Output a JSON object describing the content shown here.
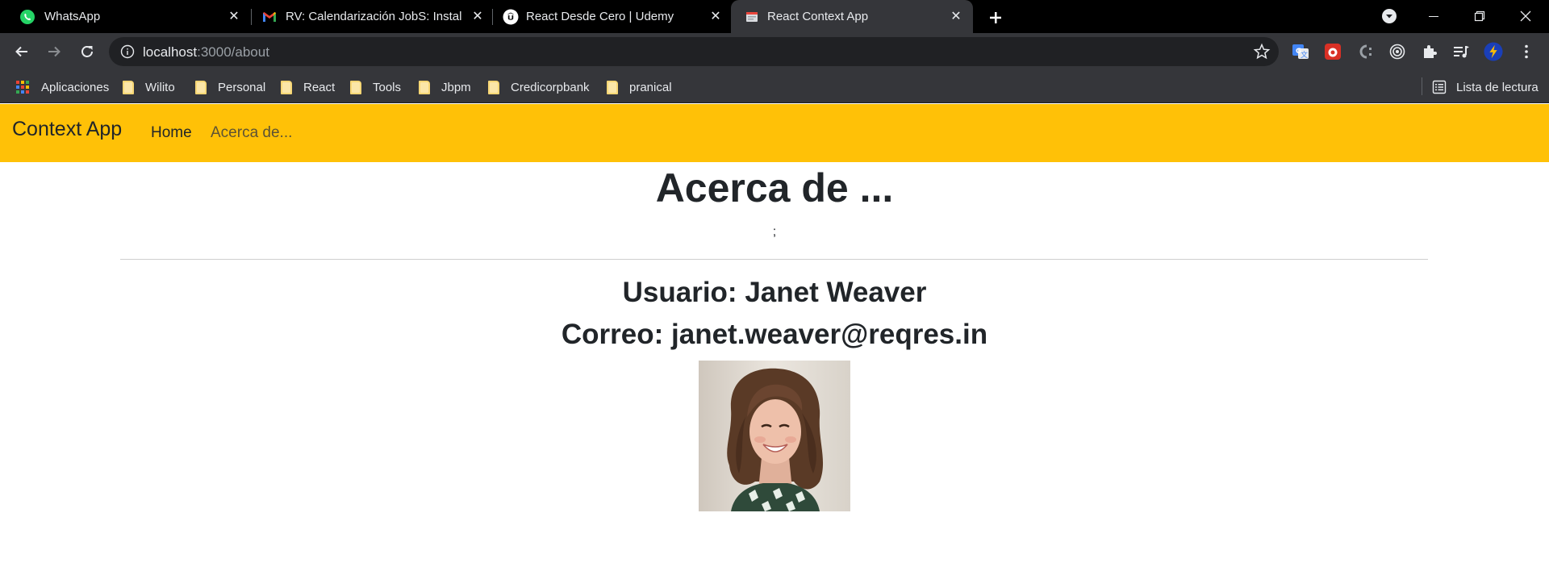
{
  "browser": {
    "tabs": [
      {
        "title": "WhatsApp",
        "icon": "whatsapp-icon",
        "active": false
      },
      {
        "title": "RV: Calendarización JobS: Instalar",
        "icon": "gmail-icon",
        "active": false
      },
      {
        "title": "React Desde Cero | Udemy",
        "icon": "udemy-icon",
        "active": false
      },
      {
        "title": "React Context App",
        "icon": "page-icon",
        "active": true
      }
    ],
    "address": {
      "host": "localhost",
      "path": ":3000/about"
    },
    "bookmarks": [
      {
        "label": "Aplicaciones",
        "icon": "apps-grid-icon"
      },
      {
        "label": "Wilito",
        "icon": "folder-icon"
      },
      {
        "label": "Personal",
        "icon": "folder-icon"
      },
      {
        "label": "React",
        "icon": "folder-icon"
      },
      {
        "label": "Tools",
        "icon": "folder-icon"
      },
      {
        "label": "Jbpm",
        "icon": "folder-icon"
      },
      {
        "label": "Credicorpbank",
        "icon": "folder-icon"
      },
      {
        "label": "pranical",
        "icon": "folder-icon"
      }
    ],
    "reading_list": "Lista de lectura"
  },
  "app": {
    "brand": "Context App",
    "nav": {
      "home": "Home",
      "about": "Acerca de..."
    },
    "accent_color": "#ffc107"
  },
  "page": {
    "title": "Acerca de ...",
    "subtitle": ";",
    "user_label": "Usuario: Janet Weaver",
    "email_label": "Correo: janet.weaver@reqres.in"
  }
}
